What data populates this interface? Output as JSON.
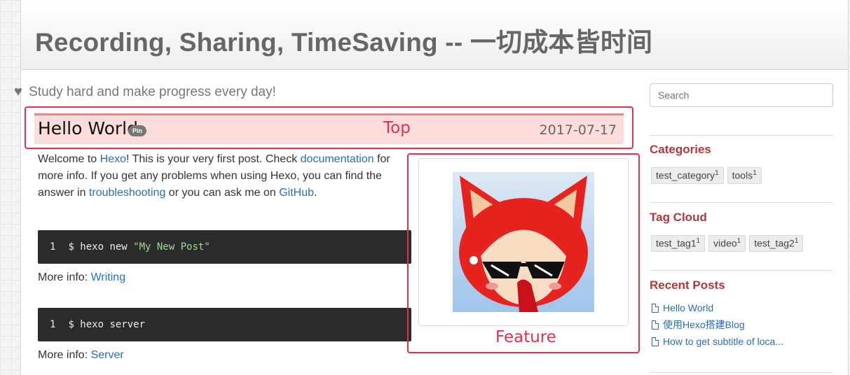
{
  "site": {
    "title": "Recording, Sharing, TimeSaving -- 一切成本皆时间",
    "subtitle": "Study hard and make progress every day!"
  },
  "post": {
    "title": "Hello World",
    "pin_badge": "Pin",
    "date": "2017-07-17",
    "p_welcome": "Welcome to ",
    "link_hexo": "Hexo",
    "p_check": "! This is your very first post. Check ",
    "link_docs": "documentation",
    "p_more": " for more info. If you get any problems when using Hexo, you can find the answer in ",
    "link_trouble": "troubleshooting",
    "p_ask": " or you can ask me on ",
    "link_github": "GitHub",
    "p_end": ".",
    "code1": {
      "line_no": "1",
      "cmd": "$ hexo new ",
      "arg": "\"My New Post\""
    },
    "more1_label": "More info: ",
    "more1_link": "Writing",
    "code2": {
      "line_no": "1",
      "cmd": "$ hexo server"
    },
    "more2_label": "More info: ",
    "more2_link": "Server"
  },
  "annotations": {
    "top_label": "Top",
    "feature_label": "Feature"
  },
  "sidebar": {
    "search_placeholder": "Search",
    "categories_heading": "Categories",
    "categories": [
      {
        "name": "test_category",
        "count": "1"
      },
      {
        "name": "tools",
        "count": "1"
      }
    ],
    "tagcloud_heading": "Tag Cloud",
    "tags": [
      {
        "name": "test_tag1",
        "count": "1"
      },
      {
        "name": "video",
        "count": "1"
      },
      {
        "name": "test_tag2",
        "count": "1"
      }
    ],
    "recent_heading": "Recent Posts",
    "recent_posts": [
      "Hello World",
      "使用Hexo搭建Blog",
      "How to get subtitle of loca..."
    ]
  },
  "colors": {
    "accent_red": "#b03a3a",
    "annotation_red": "#e0334e",
    "link_blue": "#2a6ebb",
    "pin_bg": "#fadcdc"
  },
  "icons": {
    "subtitle_icon": "heart-icon",
    "recent_icon": "document-icon"
  }
}
